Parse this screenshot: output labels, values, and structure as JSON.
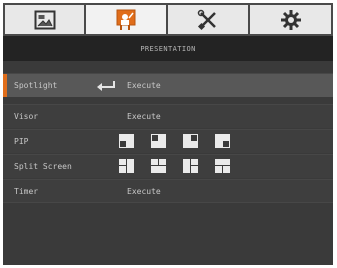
{
  "tabs": [
    {
      "icon": "picture-icon",
      "active": false
    },
    {
      "icon": "presentation-person-icon",
      "active": true
    },
    {
      "icon": "tools-icon",
      "active": false
    },
    {
      "icon": "gear-icon",
      "active": false
    }
  ],
  "colors": {
    "accent": "#e06d1a",
    "background": "#3a3a3a",
    "selected_row": "#585858",
    "title_bar": "#232323"
  },
  "title": "PRESENTATION",
  "rows": [
    {
      "label": "Spotlight",
      "value": "Execute"
    },
    {
      "label": "Visor",
      "value": "Execute"
    },
    {
      "label": "PIP",
      "value": ""
    },
    {
      "label": "Split Screen",
      "value": ""
    },
    {
      "label": "Timer",
      "value": "Execute"
    }
  ],
  "pip_options": [
    "pip-bottom-left-icon",
    "pip-top-left-icon",
    "pip-top-right-icon",
    "pip-bottom-right-icon"
  ],
  "split_options": [
    "split-left-icon",
    "split-top-icon",
    "split-right-icon",
    "split-bottom-icon"
  ]
}
